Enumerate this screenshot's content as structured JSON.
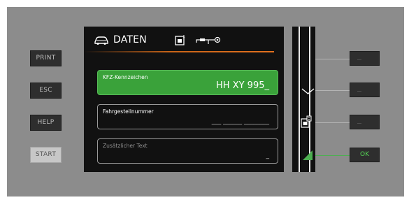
{
  "left_buttons": [
    {
      "label": "PRINT"
    },
    {
      "label": "ESC"
    },
    {
      "label": "HELP"
    },
    {
      "label": "START"
    }
  ],
  "header": {
    "title": "DATEN",
    "icons": [
      "car-icon",
      "card-reader-icon",
      "cable-plug-icon"
    ]
  },
  "fields": [
    {
      "label": "KFZ-Kennzeichen",
      "value": "HH XY 995_",
      "active": true
    },
    {
      "label": "Fahrgestellnummer",
      "value": "___ ______ ________",
      "active": false
    },
    {
      "label": "Zusätzlicher Text",
      "value": "_",
      "active": false
    }
  ],
  "right_softkeys": [
    {
      "label": ""
    },
    {
      "label": ""
    },
    {
      "label": ""
    },
    {
      "label": "OK"
    }
  ],
  "colors": {
    "accent_orange": "#e2701e",
    "active_field": "#3aa23a",
    "ok_text": "#55d455"
  }
}
